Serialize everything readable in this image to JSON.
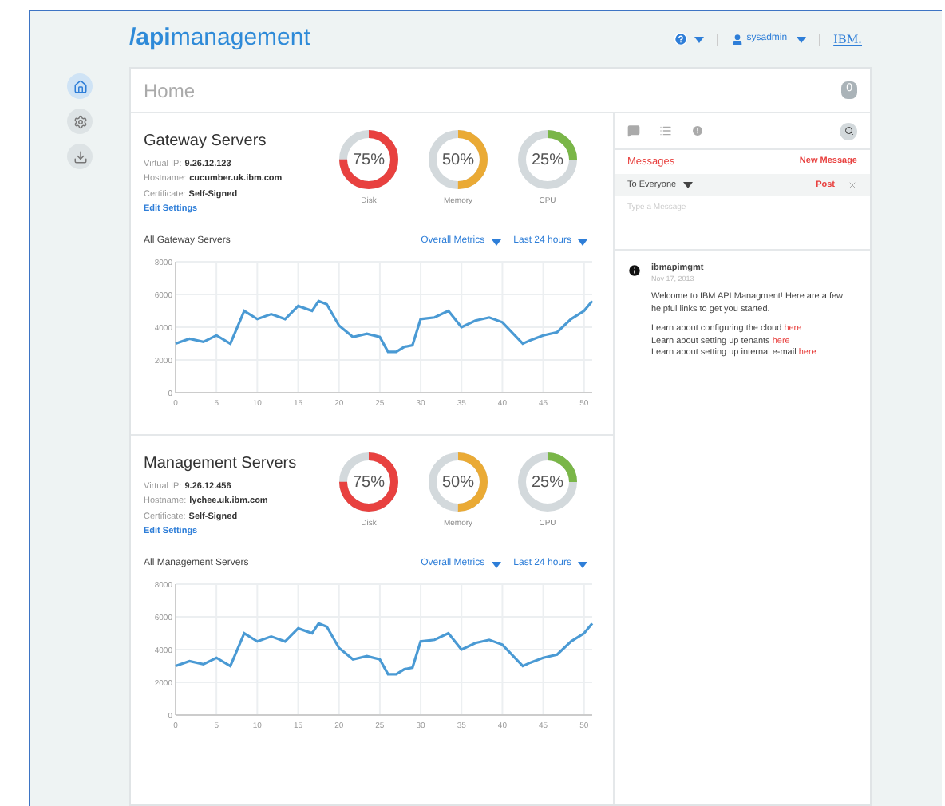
{
  "header": {
    "logo_bold": "/api",
    "logo_light": "management",
    "user": "sysadmin",
    "brand": "IBM."
  },
  "nav": [
    {
      "kind": "home",
      "selected": true
    },
    {
      "kind": "settings",
      "selected": false
    },
    {
      "kind": "download",
      "selected": false
    }
  ],
  "page_title": "Home",
  "notifications_count": "0",
  "servers": [
    {
      "title": "Gateway Servers",
      "virtual_ip_label": "Virtual IP:",
      "virtual_ip": "9.26.12.123",
      "hostname_label": "Hostname:",
      "hostname": "cucumber.uk.ibm.com",
      "certificate_label": "Certificate:",
      "certificate": "Self-Signed",
      "edit_link": "Edit Settings",
      "gauges": [
        {
          "label": "Disk",
          "reading": "75%",
          "color": "#e8413f"
        },
        {
          "label": "Memory",
          "reading": "50%",
          "color": "#eaaa35"
        },
        {
          "label": "CPU",
          "reading": "25%",
          "color": "#7ab648"
        }
      ],
      "chart_title": "All Gateway Servers",
      "metrics_dropdown": "Overall Metrics",
      "range_dropdown": "Last 24 hours",
      "chart_data": {
        "type": "line",
        "x": [
          0,
          1.7,
          3.4,
          5,
          6.7,
          8.4,
          10,
          11.7,
          13.4,
          15,
          16.7,
          17.5,
          18.5,
          20,
          21.7,
          23.4,
          25,
          26,
          27,
          28,
          29,
          30,
          31.7,
          33.4,
          35,
          36.7,
          38.4,
          40,
          42.5,
          43.4,
          45,
          46.7,
          48.4,
          50,
          51
        ],
        "grid": true,
        "series": [
          {
            "color": "#4a9ad4",
            "values": [
              3000,
              3300,
              3100,
              3500,
              3000,
              5000,
              4500,
              4800,
              4500,
              5300,
              5000,
              5600,
              5400,
              4100,
              3400,
              3600,
              3400,
              2500,
              2500,
              2800,
              2900,
              4500,
              4600,
              5000,
              4000,
              4400,
              4600,
              4300,
              3000,
              3200,
              3500,
              3700,
              4500,
              5000,
              5600
            ]
          }
        ],
        "xlim": [
          0,
          51
        ],
        "ylim": [
          0,
          8000
        ],
        "xticks": [
          0,
          5,
          10,
          15,
          20,
          25,
          30,
          35,
          40,
          45,
          50
        ],
        "yticks": [
          0,
          2000,
          4000,
          6000,
          8000
        ]
      }
    },
    {
      "title": "Management Servers",
      "virtual_ip_label": "Virtual IP:",
      "virtual_ip": "9.26.12.456",
      "hostname_label": "Hostname:",
      "hostname": "lychee.uk.ibm.com",
      "certificate_label": "Certificate:",
      "certificate": "Self-Signed",
      "edit_link": "Edit Settings",
      "gauges": [
        {
          "label": "Disk",
          "reading": "75%",
          "color": "#e8413f"
        },
        {
          "label": "Memory",
          "reading": "50%",
          "color": "#eaaa35"
        },
        {
          "label": "CPU",
          "reading": "25%",
          "color": "#7ab648"
        }
      ],
      "chart_title": "All Management Servers",
      "metrics_dropdown": "Overall Metrics",
      "range_dropdown": "Last 24 hours",
      "chart_data": {
        "type": "line",
        "x": [
          0,
          1.7,
          3.4,
          5,
          6.7,
          8.4,
          10,
          11.7,
          13.4,
          15,
          16.7,
          17.5,
          18.5,
          20,
          21.7,
          23.4,
          25,
          26,
          27,
          28,
          29,
          30,
          31.7,
          33.4,
          35,
          36.7,
          38.4,
          40,
          42.5,
          43.4,
          45,
          46.7,
          48.4,
          50,
          51
        ],
        "grid": true,
        "series": [
          {
            "color": "#4a9ad4",
            "values": [
              3000,
              3300,
              3100,
              3500,
              3000,
              5000,
              4500,
              4800,
              4500,
              5300,
              5000,
              5600,
              5400,
              4100,
              3400,
              3600,
              3400,
              2500,
              2500,
              2800,
              2900,
              4500,
              4600,
              5000,
              4000,
              4400,
              4600,
              4300,
              3000,
              3200,
              3500,
              3700,
              4500,
              5000,
              5600
            ]
          }
        ],
        "xlim": [
          0,
          51
        ],
        "ylim": [
          0,
          8000
        ],
        "xticks": [
          0,
          5,
          10,
          15,
          20,
          25,
          30,
          35,
          40,
          45,
          50
        ],
        "yticks": [
          0,
          2000,
          4000,
          6000,
          8000
        ]
      }
    }
  ],
  "messages": {
    "heading": "Messages",
    "new_message": "New Message",
    "audience": "To Everyone",
    "post": "Post",
    "placeholder": "Type a Message",
    "message": {
      "author": "ibmapimgmt",
      "date": "Nov 17, 2013",
      "body": "Welcome to IBM API Managment! Here are a few helpful links to get you started.",
      "links": [
        {
          "text": "Learn about configuring the cloud",
          "link": "here"
        },
        {
          "text": "Learn about setting up tenants",
          "link": "here"
        },
        {
          "text": "Learn about setting up internal e-mail",
          "link": "here"
        }
      ]
    }
  }
}
